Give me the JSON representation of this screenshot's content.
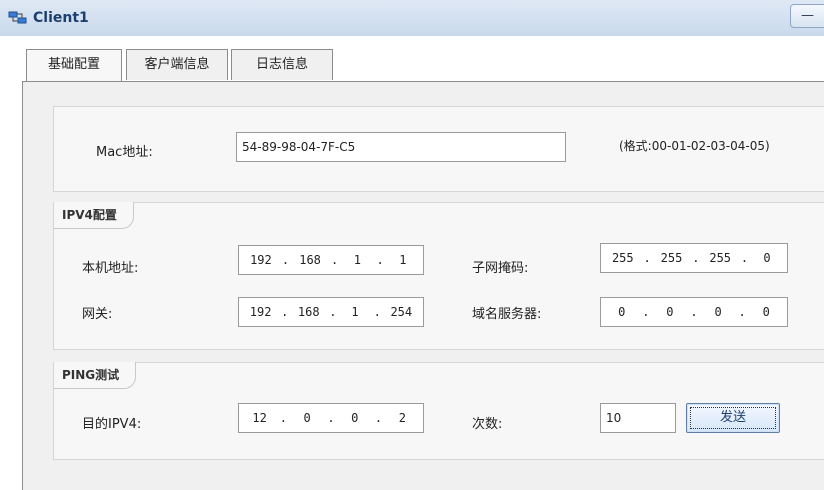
{
  "window": {
    "title": "Client1",
    "minimize_glyph": "—"
  },
  "tabs": [
    {
      "label": "基础配置",
      "active": true
    },
    {
      "label": "客户端信息",
      "active": false
    },
    {
      "label": "日志信息",
      "active": false
    }
  ],
  "mac": {
    "label": "Mac地址:",
    "value": "54-89-98-04-7F-C5",
    "hint": "(格式:00-01-02-03-04-05)"
  },
  "ipv4": {
    "title": "IPV4配置",
    "local_addr": {
      "label": "本机地址:",
      "octets": [
        "192",
        "168",
        "1",
        "1"
      ]
    },
    "mask": {
      "label": "子网掩码:",
      "octets": [
        "255",
        "255",
        "255",
        "0"
      ]
    },
    "gateway": {
      "label": "网关:",
      "octets": [
        "192",
        "168",
        "1",
        "254"
      ]
    },
    "dns": {
      "label": "域名服务器:",
      "octets": [
        "0",
        "0",
        "0",
        "0"
      ]
    }
  },
  "ping": {
    "title": "PING测试",
    "dest": {
      "label": "目的IPV4:",
      "octets": [
        "12",
        "0",
        "0",
        "2"
      ]
    },
    "count": {
      "label": "次数:",
      "value": "10"
    },
    "send_label": "发送"
  },
  "colors": {
    "titlebar": "#c9d9ec",
    "title_text": "#1d3f6e",
    "panel_bg": "#f0f0f0"
  },
  "icons": {
    "app": "network-client-icon"
  }
}
